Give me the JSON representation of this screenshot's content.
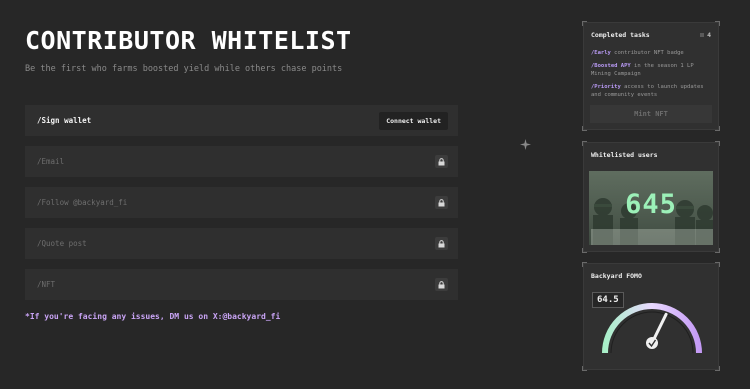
{
  "header": {
    "title": "CONTRIBUTOR WHITELIST",
    "subtitle": "Be the first who farms boosted yield while others chase points"
  },
  "steps": [
    {
      "label": "/Sign wallet",
      "action_label": "Connect wallet",
      "locked": false
    },
    {
      "label": "/Email",
      "locked": true,
      "icon": "lock-icon"
    },
    {
      "label": "/Follow @backyard_fi",
      "locked": true,
      "icon": "lock-icon"
    },
    {
      "label": "/Quote post",
      "locked": true,
      "icon": "lock-icon"
    },
    {
      "label": "/NFT",
      "locked": true,
      "icon": "lock-icon"
    }
  ],
  "help_text": "*If you're facing any issues, DM us on X:@backyard_fi",
  "completed_tasks": {
    "title": "Completed tasks",
    "count": "4",
    "items": [
      {
        "tag": "/Early",
        "text": " contributor NFT badge"
      },
      {
        "tag": "/Boosted APY",
        "text": " in the season 1 LP Mining Campaign"
      },
      {
        "tag": "/Priority",
        "text": " access to launch updates and community events"
      }
    ],
    "mint_label": "Mint NFT"
  },
  "whitelisted": {
    "title": "Whitelisted users",
    "count": "645"
  },
  "fomo": {
    "title": "Backyard FOMO",
    "value": "64.5",
    "gauge_fraction": 0.645
  },
  "colors": {
    "background": "#272727",
    "accent_purple": "#c9a4f5",
    "users_green": "#9cf0b8"
  }
}
